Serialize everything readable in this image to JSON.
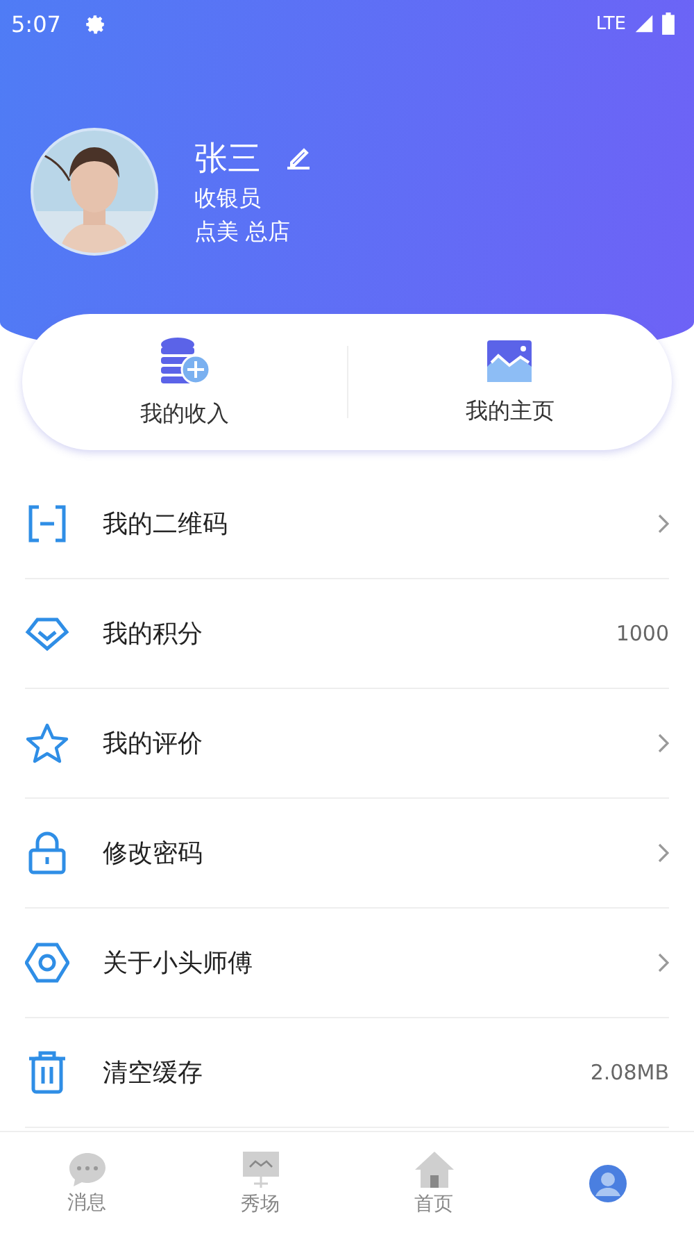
{
  "status_bar": {
    "time": "5:07",
    "network": "LTE"
  },
  "profile": {
    "name": "张三",
    "role": "收银员",
    "store": "点美  总店"
  },
  "shortcuts": [
    {
      "label": "我的收入"
    },
    {
      "label": "我的主页"
    }
  ],
  "menu": [
    {
      "label": "我的二维码",
      "kind": "link"
    },
    {
      "label": "我的积分",
      "kind": "value",
      "value": "1000"
    },
    {
      "label": "我的评价",
      "kind": "link"
    },
    {
      "label": "修改密码",
      "kind": "link"
    },
    {
      "label": "关于小头师傅",
      "kind": "link"
    },
    {
      "label": "清空缓存",
      "kind": "value",
      "value": "2.08MB"
    }
  ],
  "tabs": [
    {
      "label": "消息",
      "selected": false
    },
    {
      "label": "秀场",
      "selected": false
    },
    {
      "label": "首页",
      "selected": false
    },
    {
      "selected": true
    }
  ]
}
